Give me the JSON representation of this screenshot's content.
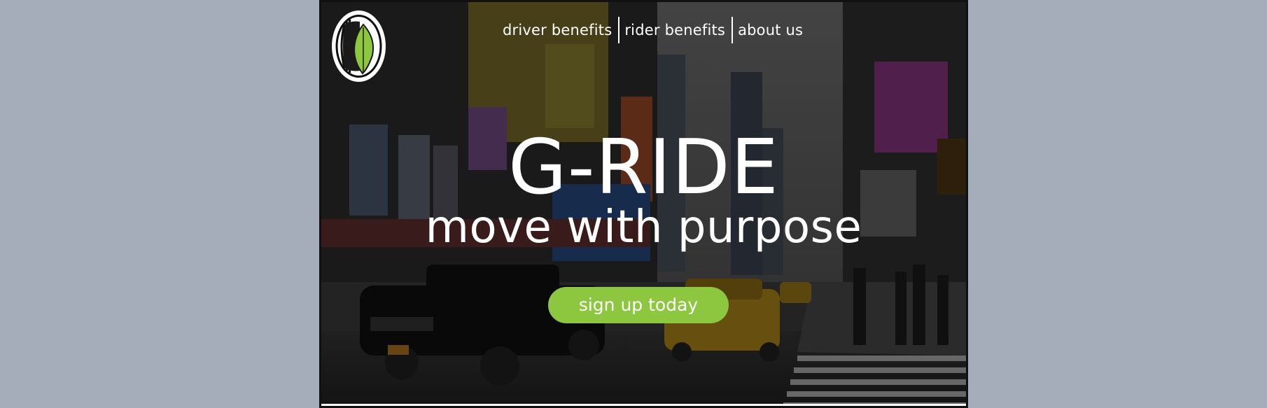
{
  "nav": {
    "items": [
      {
        "label": "driver benefits"
      },
      {
        "label": "rider benefits"
      },
      {
        "label": "about us"
      }
    ]
  },
  "hero": {
    "title": "G-RIDE",
    "tagline": "move with purpose",
    "cta_label": "sign up today"
  },
  "logo": {
    "icon": "tire-leaf-logo"
  },
  "colors": {
    "page_background": "#a5acba",
    "accent_green": "#8dc63f",
    "text": "#ffffff"
  }
}
